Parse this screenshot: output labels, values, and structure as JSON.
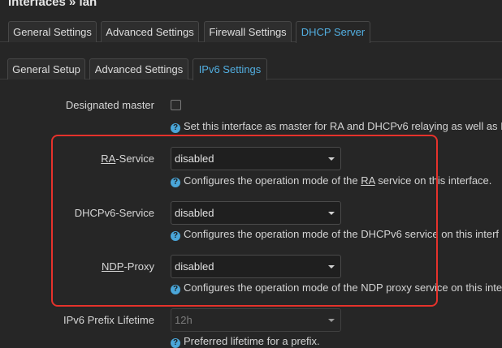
{
  "page": {
    "title": "Interfaces » lan"
  },
  "top_tabs": [
    {
      "label": "General Settings"
    },
    {
      "label": "Advanced Settings"
    },
    {
      "label": "Firewall Settings"
    },
    {
      "label": "DHCP Server"
    }
  ],
  "sub_tabs": [
    {
      "label": "General Setup"
    },
    {
      "label": "Advanced Settings"
    },
    {
      "label": "IPv6 Settings"
    }
  ],
  "fields": {
    "designated_master": {
      "label": "Designated master",
      "checked": false,
      "help": "Set this interface as master for RA and DHCPv6 relaying as well as I"
    },
    "ra_service": {
      "label_u": "RA",
      "label_rest": "-Service",
      "value": "disabled",
      "help_a": "Configures the operation mode of the ",
      "help_u": "RA",
      "help_b": " service on this interface."
    },
    "dhcpv6_service": {
      "label": "DHCPv6-Service",
      "value": "disabled",
      "help": "Configures the operation mode of the DHCPv6 service on this interf"
    },
    "ndp_proxy": {
      "label_u": "NDP",
      "label_rest": "-Proxy",
      "value": "disabled",
      "help": "Configures the operation mode of the NDP proxy service on this inte"
    },
    "ipv6_prefix_lifetime": {
      "label": "IPv6 Prefix Lifetime",
      "value": "12h",
      "help": "Preferred lifetime for a prefix."
    }
  },
  "icons": {
    "help": "question-circle-icon",
    "dropdown": "caret-down-icon"
  },
  "colors": {
    "accent": "#52aee0",
    "highlight": "#e5322b"
  }
}
